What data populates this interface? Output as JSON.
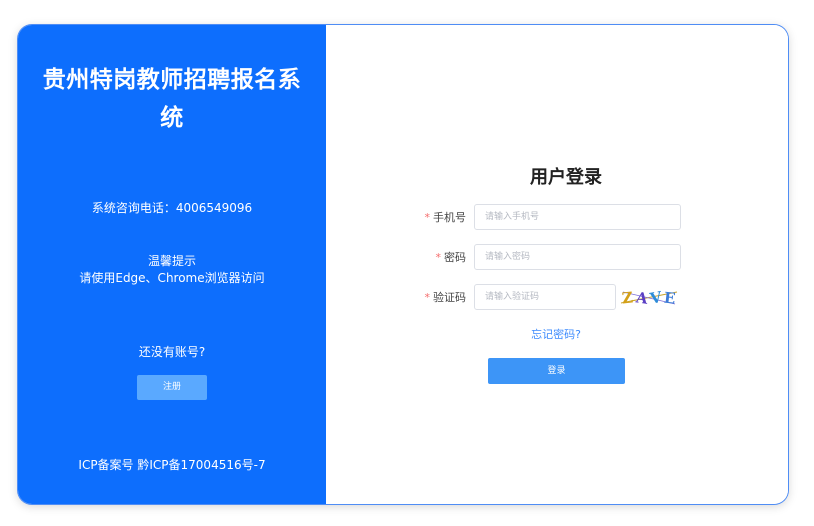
{
  "left_panel": {
    "title": "贵州特岗教师招聘报名系统",
    "phone_line": "系统咨询电话：4006549096",
    "tip_title": "温馨提示",
    "tip_text": "请使用Edge、Chrome浏览器访问",
    "no_account": "还没有账号?",
    "register_label": "注册",
    "icp": "ICP备案号 黔ICP备17004516号-7",
    "background_color": "#0d6efd"
  },
  "login_form": {
    "title": "用户登录",
    "required_mark": "*",
    "phone": {
      "label": "手机号",
      "placeholder": "请输入手机号",
      "value": ""
    },
    "password": {
      "label": "密码",
      "placeholder": "请输入密码",
      "value": ""
    },
    "captcha": {
      "label": "验证码",
      "placeholder": "请输入验证码",
      "value": "",
      "image_text": "ZAVE"
    },
    "forgot_label": "忘记密码?",
    "login_label": "登录",
    "accent_color": "#3d95f7"
  }
}
